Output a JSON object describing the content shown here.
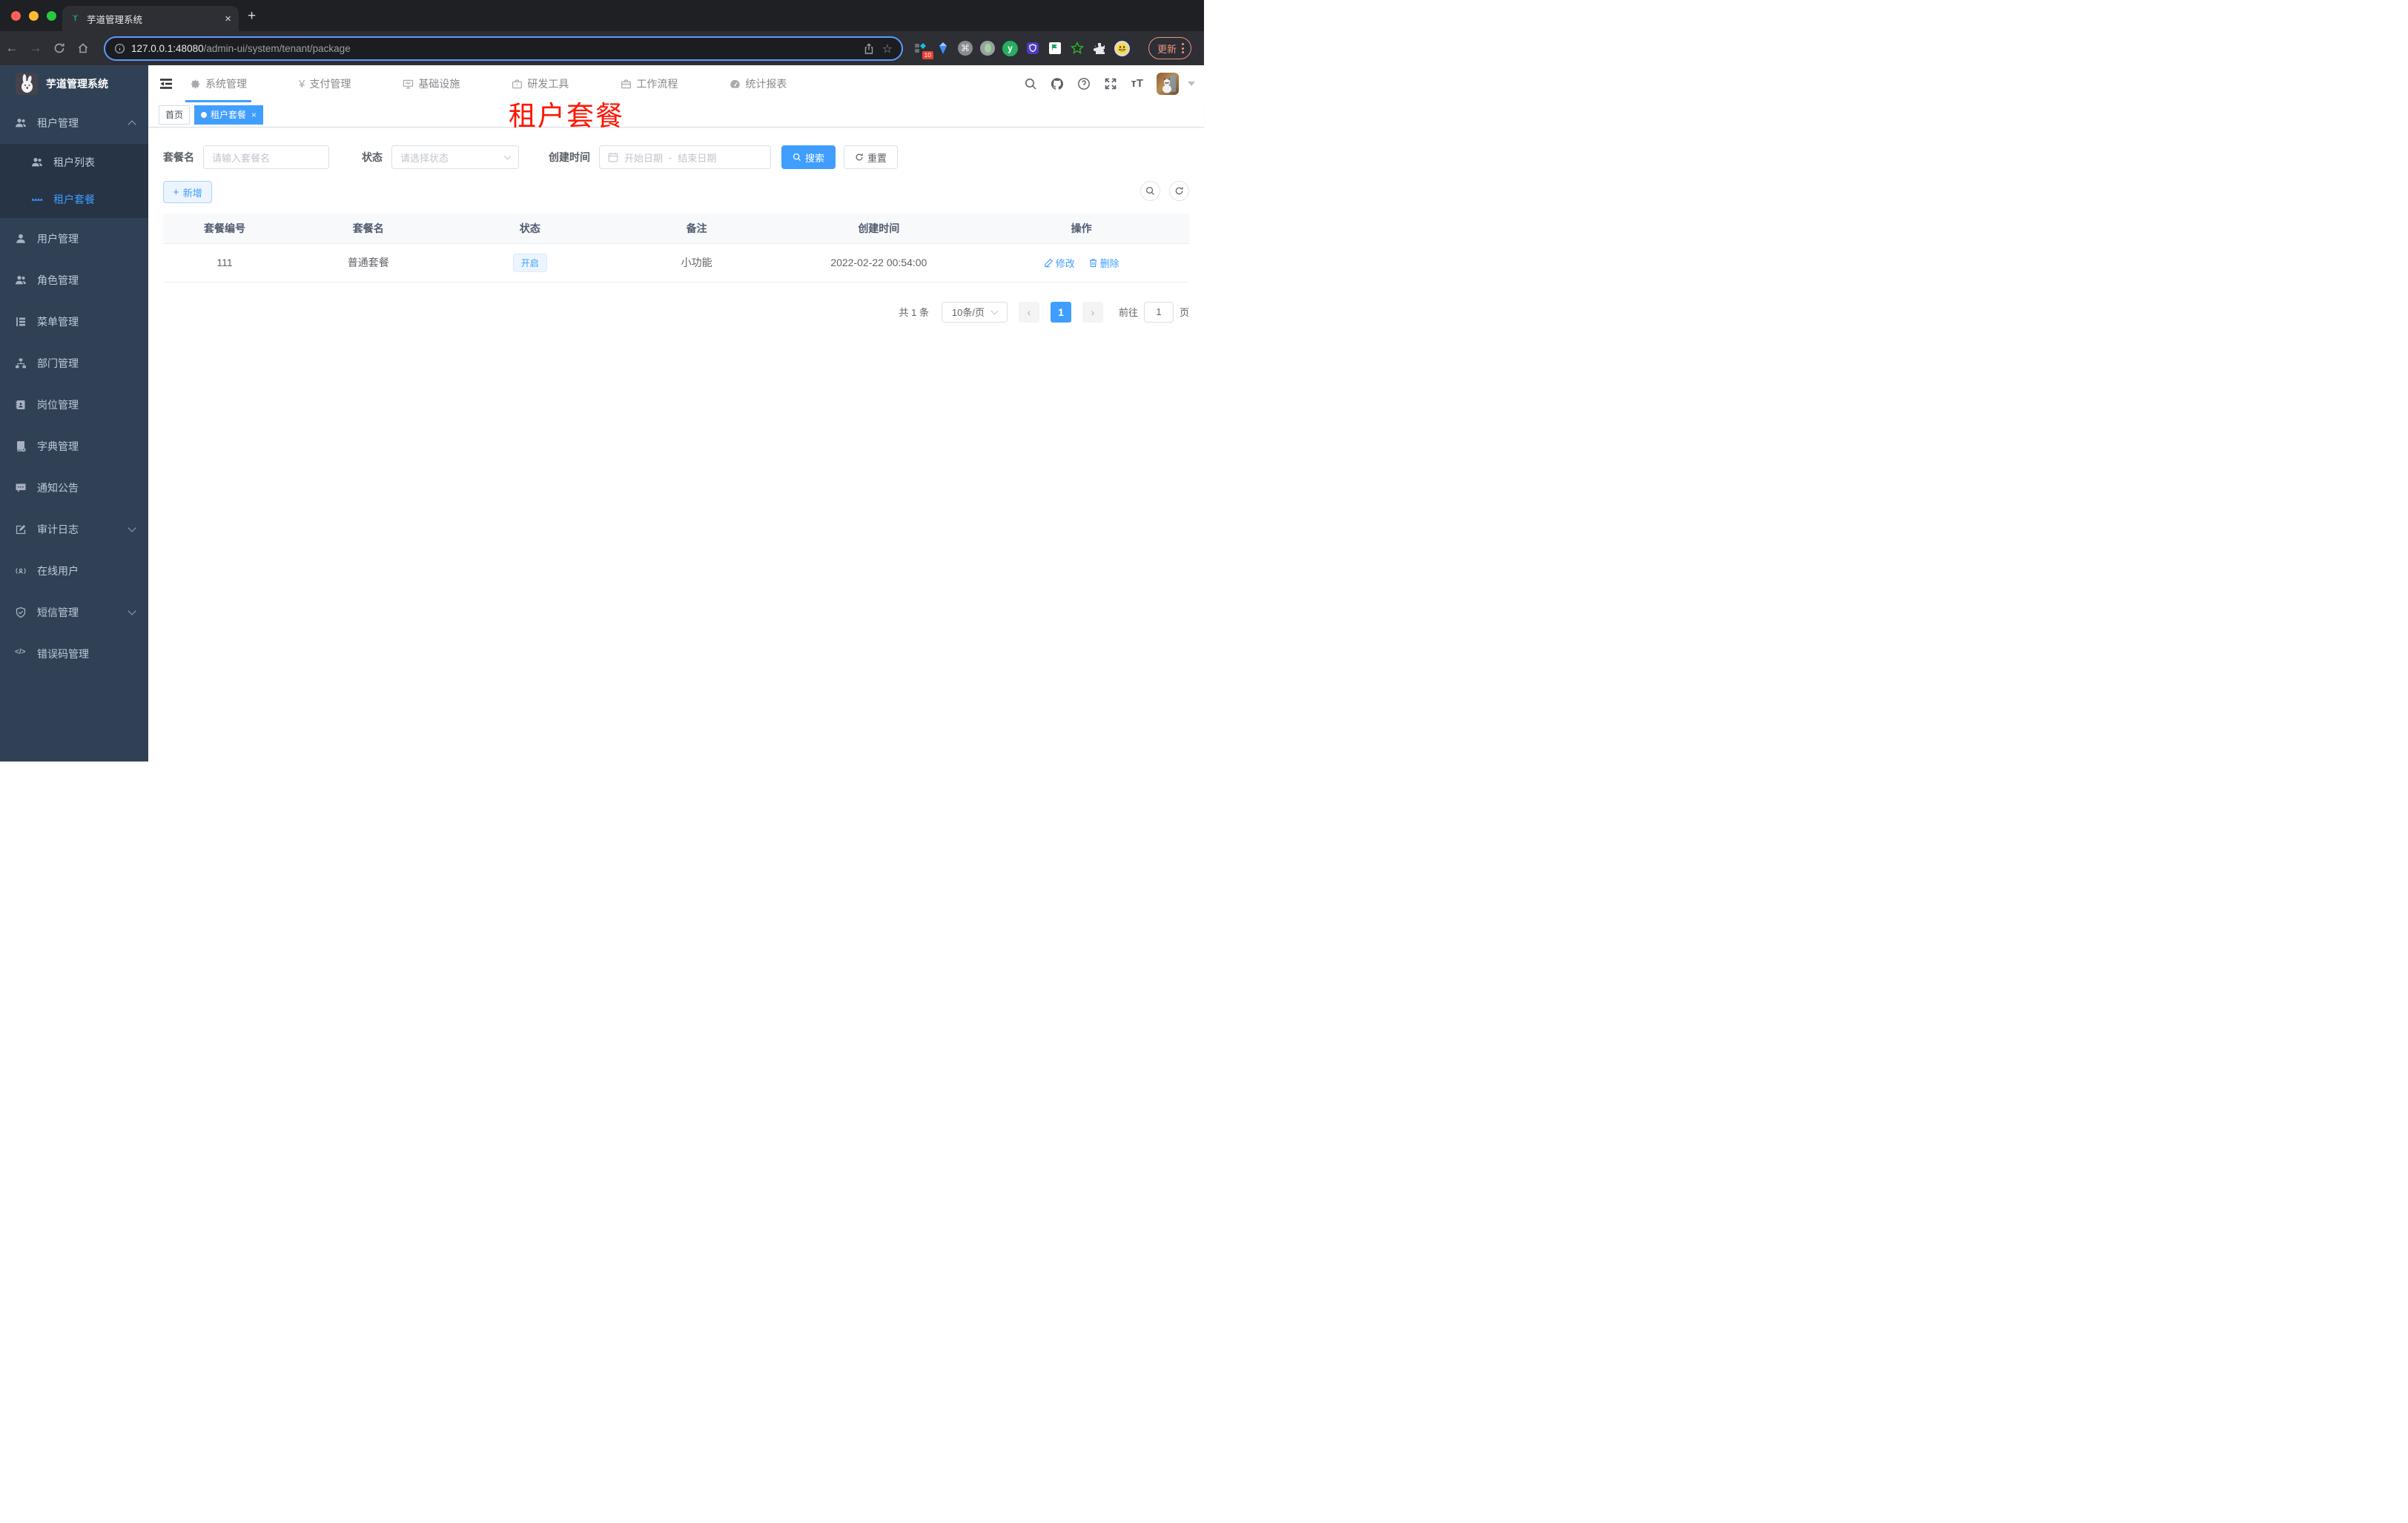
{
  "browser": {
    "tab_title": "芋道管理系统",
    "close_tab": "×",
    "new_tab": "+",
    "url_host": "127.0.0.1:48080",
    "url_path": "/admin-ui/system/tenant/package",
    "back": "←",
    "forward": "→",
    "ext_badge": "10",
    "cmd_glyph": "⌘",
    "star_glyph": "☆",
    "update_label": "更新"
  },
  "topnav": {
    "items": [
      {
        "label": "系统管理"
      },
      {
        "label": "支付管理"
      },
      {
        "label": "基础设施"
      },
      {
        "label": "研发工具"
      },
      {
        "label": "工作流程"
      },
      {
        "label": "统计报表"
      }
    ],
    "yen_glyph": "¥"
  },
  "sidebar": {
    "app_title": "芋道管理系统",
    "tenant_group_label": "租户管理",
    "tenant_children": [
      {
        "label": "租户列表"
      },
      {
        "label": "租户套餐"
      }
    ],
    "items": [
      {
        "label": "用户管理"
      },
      {
        "label": "角色管理"
      },
      {
        "label": "菜单管理"
      },
      {
        "label": "部门管理"
      },
      {
        "label": "岗位管理"
      },
      {
        "label": "字典管理"
      },
      {
        "label": "通知公告"
      },
      {
        "label": "审计日志"
      },
      {
        "label": "在线用户"
      },
      {
        "label": "短信管理"
      },
      {
        "label": "错误码管理"
      }
    ],
    "code_glyph": "</>"
  },
  "tags_view": {
    "tabs": [
      {
        "label": "首页"
      },
      {
        "label": "租户套餐"
      }
    ],
    "close_glyph": "×"
  },
  "overlay_title": "租户套餐",
  "filters": {
    "name_label": "套餐名",
    "name_placeholder": "请输入套餐名",
    "status_label": "状态",
    "status_placeholder": "请选择状态",
    "time_label": "创建时间",
    "start_placeholder": "开始日期",
    "range_separator": "-",
    "end_placeholder": "结束日期",
    "search_label": "搜索",
    "reset_label": "重置"
  },
  "toolbar": {
    "add_label": "新增",
    "plus_glyph": "+"
  },
  "table": {
    "headers": [
      "套餐编号",
      "套餐名",
      "状态",
      "备注",
      "创建时间",
      "操作"
    ],
    "rows": [
      {
        "id": "111",
        "name": "普通套餐",
        "status": "开启",
        "remark": "小功能",
        "created_at": "2022-02-22 00:54:00",
        "edit_label": "修改",
        "delete_label": "删除"
      }
    ]
  },
  "pagination": {
    "total": "共 1 条",
    "page_size": "10条/页",
    "prev": "‹",
    "current": "1",
    "next": "›",
    "goto_label": "前往",
    "goto_value": "1",
    "unit_label": "页"
  },
  "colors": {
    "primary": "#409eff",
    "sidebar_bg": "#304156",
    "submenu_bg": "#263445",
    "overlay_red": "#ff1500",
    "tag_bg": "#ecf5ff"
  }
}
